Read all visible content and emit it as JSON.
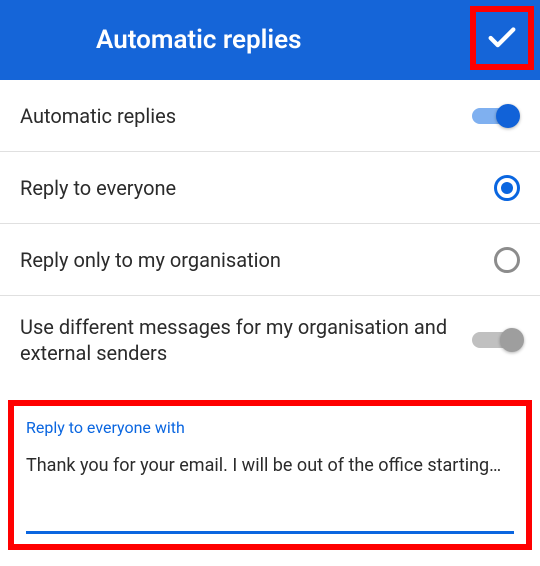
{
  "header": {
    "title": "Automatic replies"
  },
  "rows": {
    "auto_replies": {
      "label": "Automatic replies",
      "on": true
    },
    "reply_everyone": {
      "label": "Reply to everyone",
      "selected": true
    },
    "reply_org": {
      "label": "Reply only to my organisation",
      "selected": false
    },
    "diff_msgs": {
      "label": "Use different messages for my organisation and external senders",
      "on": false
    }
  },
  "message": {
    "label": "Reply to everyone with",
    "text": "Thank you for your email. I will be out of the office starting…"
  }
}
